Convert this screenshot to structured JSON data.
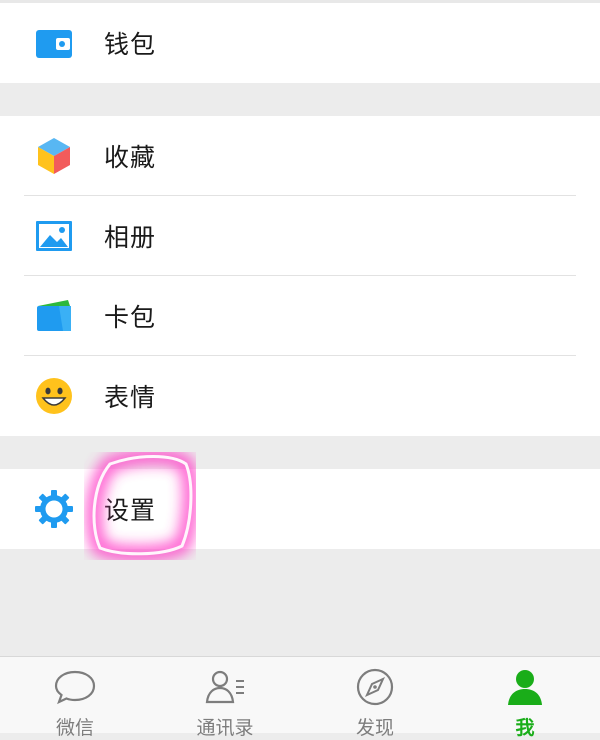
{
  "wallet_section": {
    "items": [
      {
        "label": "钱包",
        "icon": "wallet-icon"
      }
    ]
  },
  "features_section": {
    "items": [
      {
        "label": "收藏",
        "icon": "favorites-cube-icon"
      },
      {
        "label": "相册",
        "icon": "album-picture-icon"
      },
      {
        "label": "卡包",
        "icon": "card-wallet-icon"
      },
      {
        "label": "表情",
        "icon": "smiley-face-icon"
      }
    ]
  },
  "settings_section": {
    "items": [
      {
        "label": "设置",
        "icon": "gear-icon"
      }
    ]
  },
  "tabbar": {
    "tabs": [
      {
        "label": "微信",
        "icon": "chat-bubble-icon",
        "active": false
      },
      {
        "label": "通讯录",
        "icon": "contacts-icon",
        "active": false
      },
      {
        "label": "发现",
        "icon": "compass-icon",
        "active": false
      },
      {
        "label": "我",
        "icon": "person-icon",
        "active": true
      }
    ]
  },
  "colors": {
    "accent": "#1aad19",
    "background": "#ececec",
    "highlight": "#ff3fc8",
    "icon_blue": "#1f9bf0",
    "inactive_tab": "#7d7d7d"
  }
}
